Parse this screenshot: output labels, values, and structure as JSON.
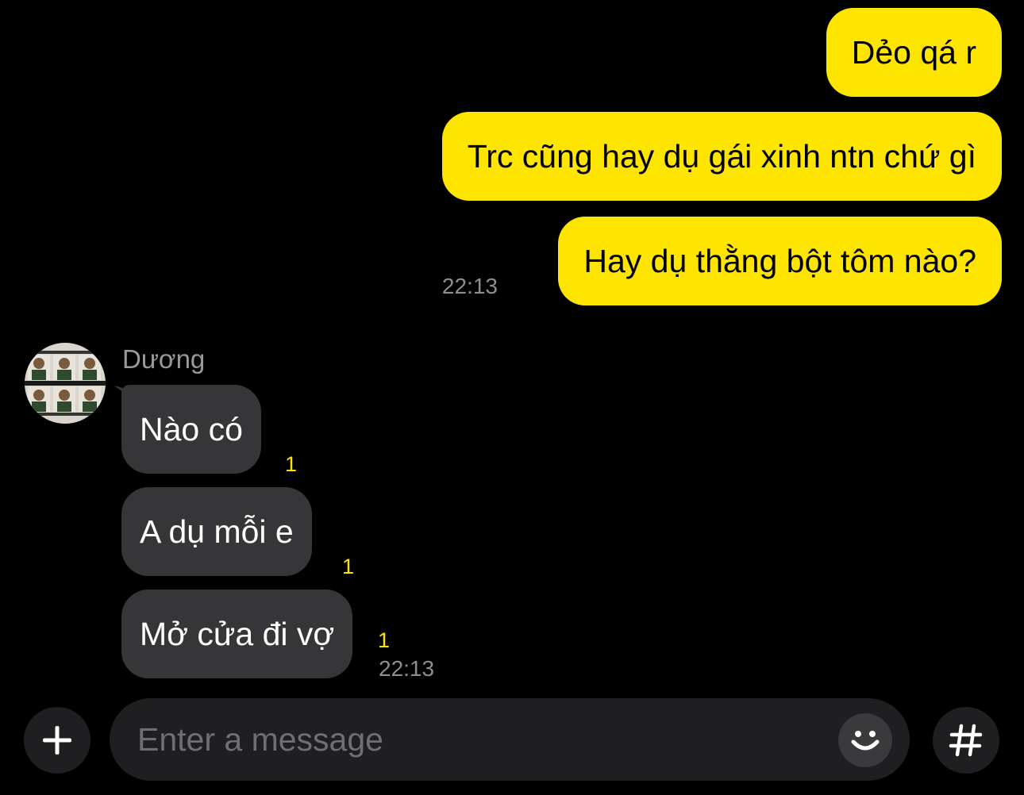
{
  "theme": {
    "outgoing_bubble_color": "#FEE500",
    "incoming_bubble_color": "#363638",
    "background": "#000000",
    "unread_color": "#FEE500"
  },
  "outgoing": {
    "messages": [
      {
        "text": "Dẻo qá r"
      },
      {
        "text": "Trc cũng hay dụ gái xinh ntn chứ gì"
      },
      {
        "text": "Hay dụ thằng bột tôm nào?"
      }
    ],
    "time": "22:13"
  },
  "incoming": {
    "sender": "Dương",
    "avatar_icon": "avatar-photo-grid",
    "messages": [
      {
        "text": "Nào có",
        "unread": "1"
      },
      {
        "text": "A dụ mỗi e",
        "unread": "1"
      },
      {
        "text": "Mở cửa đi vợ",
        "unread": "1"
      }
    ],
    "time": "22:13"
  },
  "composer": {
    "placeholder": "Enter a message",
    "plus_icon": "plus-icon",
    "emoji_icon": "emoji-icon",
    "hash_icon": "hashtag-icon"
  }
}
